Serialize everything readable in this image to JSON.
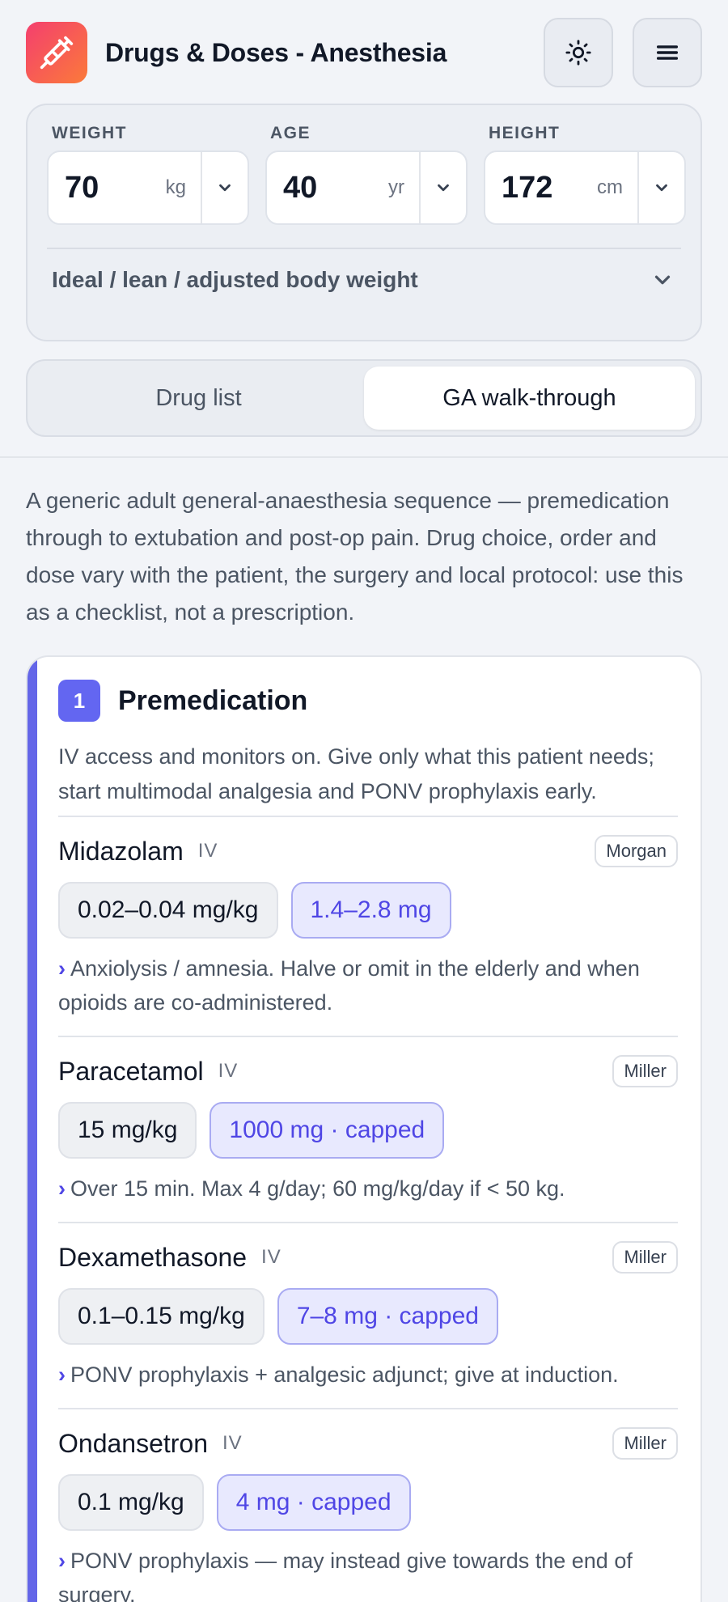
{
  "app": {
    "title": "Drugs & Doses - Anesthesia"
  },
  "header": {
    "logo_icon": "syringe-icon",
    "theme_icon": "sun-icon",
    "menu_icon": "hamburger-menu-icon"
  },
  "patient": {
    "weight": {
      "label": "WEIGHT",
      "value": "70",
      "unit": "kg"
    },
    "age": {
      "label": "AGE",
      "value": "40",
      "unit": "yr"
    },
    "height": {
      "label": "HEIGHT",
      "value": "172",
      "unit": "cm"
    },
    "ibw_label": "Ideal / lean / adjusted body weight"
  },
  "tabs": {
    "drug_list": "Drug list",
    "walkthrough": "GA walk-through",
    "active": "walkthrough"
  },
  "intro": "A generic adult general-anaesthesia sequence — premedication through to extubation and post-op pain. Drug choice, order and dose vary with the patient, the surgery and local protocol: use this as a checklist, not a prescription.",
  "step": {
    "number": "1",
    "title": "Premedication",
    "description": "IV access and monitors on. Give only what this patient needs; start multimodal analgesia and PONV prophylaxis early.",
    "accent": "#6466e8",
    "drugs": [
      {
        "name": "Midazolam",
        "route": "IV",
        "source": "Morgan",
        "dose_per_kg": "0.02–0.04 mg/kg",
        "dose_calc": "1.4–2.8 mg",
        "note": "Anxiolysis / amnesia. Halve or omit in the elderly and when opioids are co-administered."
      },
      {
        "name": "Paracetamol",
        "route": "IV",
        "source": "Miller",
        "dose_per_kg": "15 mg/kg",
        "dose_calc": "1000 mg · capped",
        "note": "Over 15 min. Max 4 g/day; 60 mg/kg/day if < 50 kg."
      },
      {
        "name": "Dexamethasone",
        "route": "IV",
        "source": "Miller",
        "dose_per_kg": "0.1–0.15 mg/kg",
        "dose_calc": "7–8 mg · capped",
        "note": "PONV prophylaxis + analgesic adjunct; give at induction."
      },
      {
        "name": "Ondansetron",
        "route": "IV",
        "source": "Miller",
        "dose_per_kg": "0.1 mg/kg",
        "dose_calc": "4 mg · capped",
        "note": "PONV prophylaxis — may instead give towards the end of surgery."
      }
    ]
  }
}
